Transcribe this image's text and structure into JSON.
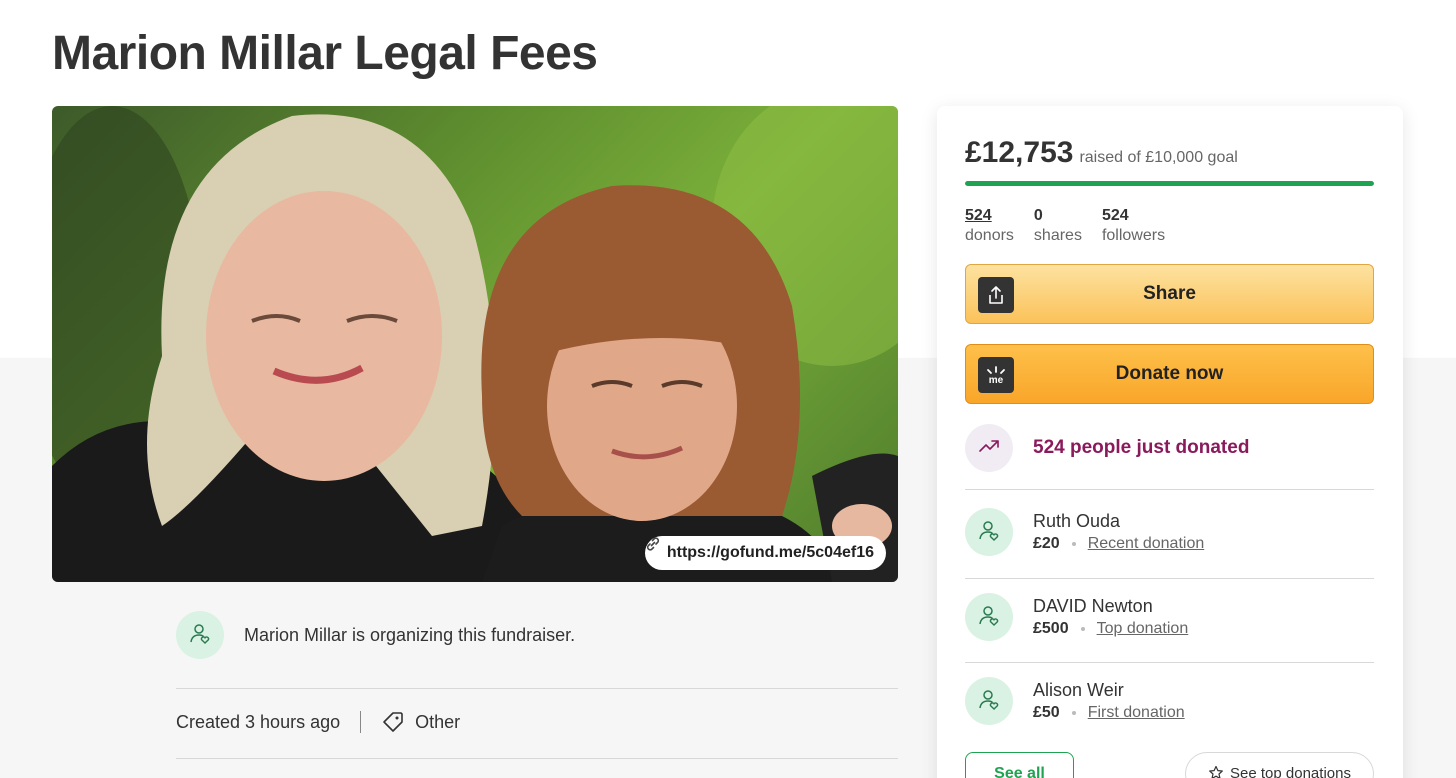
{
  "page": {
    "title": "Marion Millar Legal Fees"
  },
  "hero": {
    "short_link": "https://gofund.me/5c04ef16",
    "link_icon": "link-icon"
  },
  "organizer": {
    "text": "Marion Millar is organizing this fundraiser.",
    "icon": "person-heart-icon"
  },
  "meta": {
    "created": "Created 3 hours ago",
    "category": "Other",
    "category_icon": "tag-icon"
  },
  "progress": {
    "amount": "£12,753",
    "goal_text": "raised of £10,000 goal",
    "fraction": 1.0
  },
  "stats": [
    {
      "num": "524",
      "label": "donors"
    },
    {
      "num": "0",
      "label": "shares"
    },
    {
      "num": "524",
      "label": "followers"
    }
  ],
  "buttons": {
    "share": "Share",
    "share_icon": "share-upload-icon",
    "donate": "Donate now",
    "donate_icon": "gofundme-logo-icon"
  },
  "trend": {
    "text": "524 people just donated",
    "icon": "trending-up-icon"
  },
  "donors": [
    {
      "name": "Ruth Ouda",
      "amount": "£20",
      "type": "Recent donation"
    },
    {
      "name": "DAVID Newton",
      "amount": "£500",
      "type": "Top donation"
    },
    {
      "name": "Alison Weir",
      "amount": "£50",
      "type": "First donation"
    }
  ],
  "footer_buttons": {
    "see_all": "See all",
    "see_top": "See top donations",
    "star_icon": "star-icon"
  },
  "colors": {
    "progress": "#1fa352",
    "trend_text": "#8a1a5c",
    "share_button": "#fbc25a",
    "donate_button": "#f9a62a"
  }
}
